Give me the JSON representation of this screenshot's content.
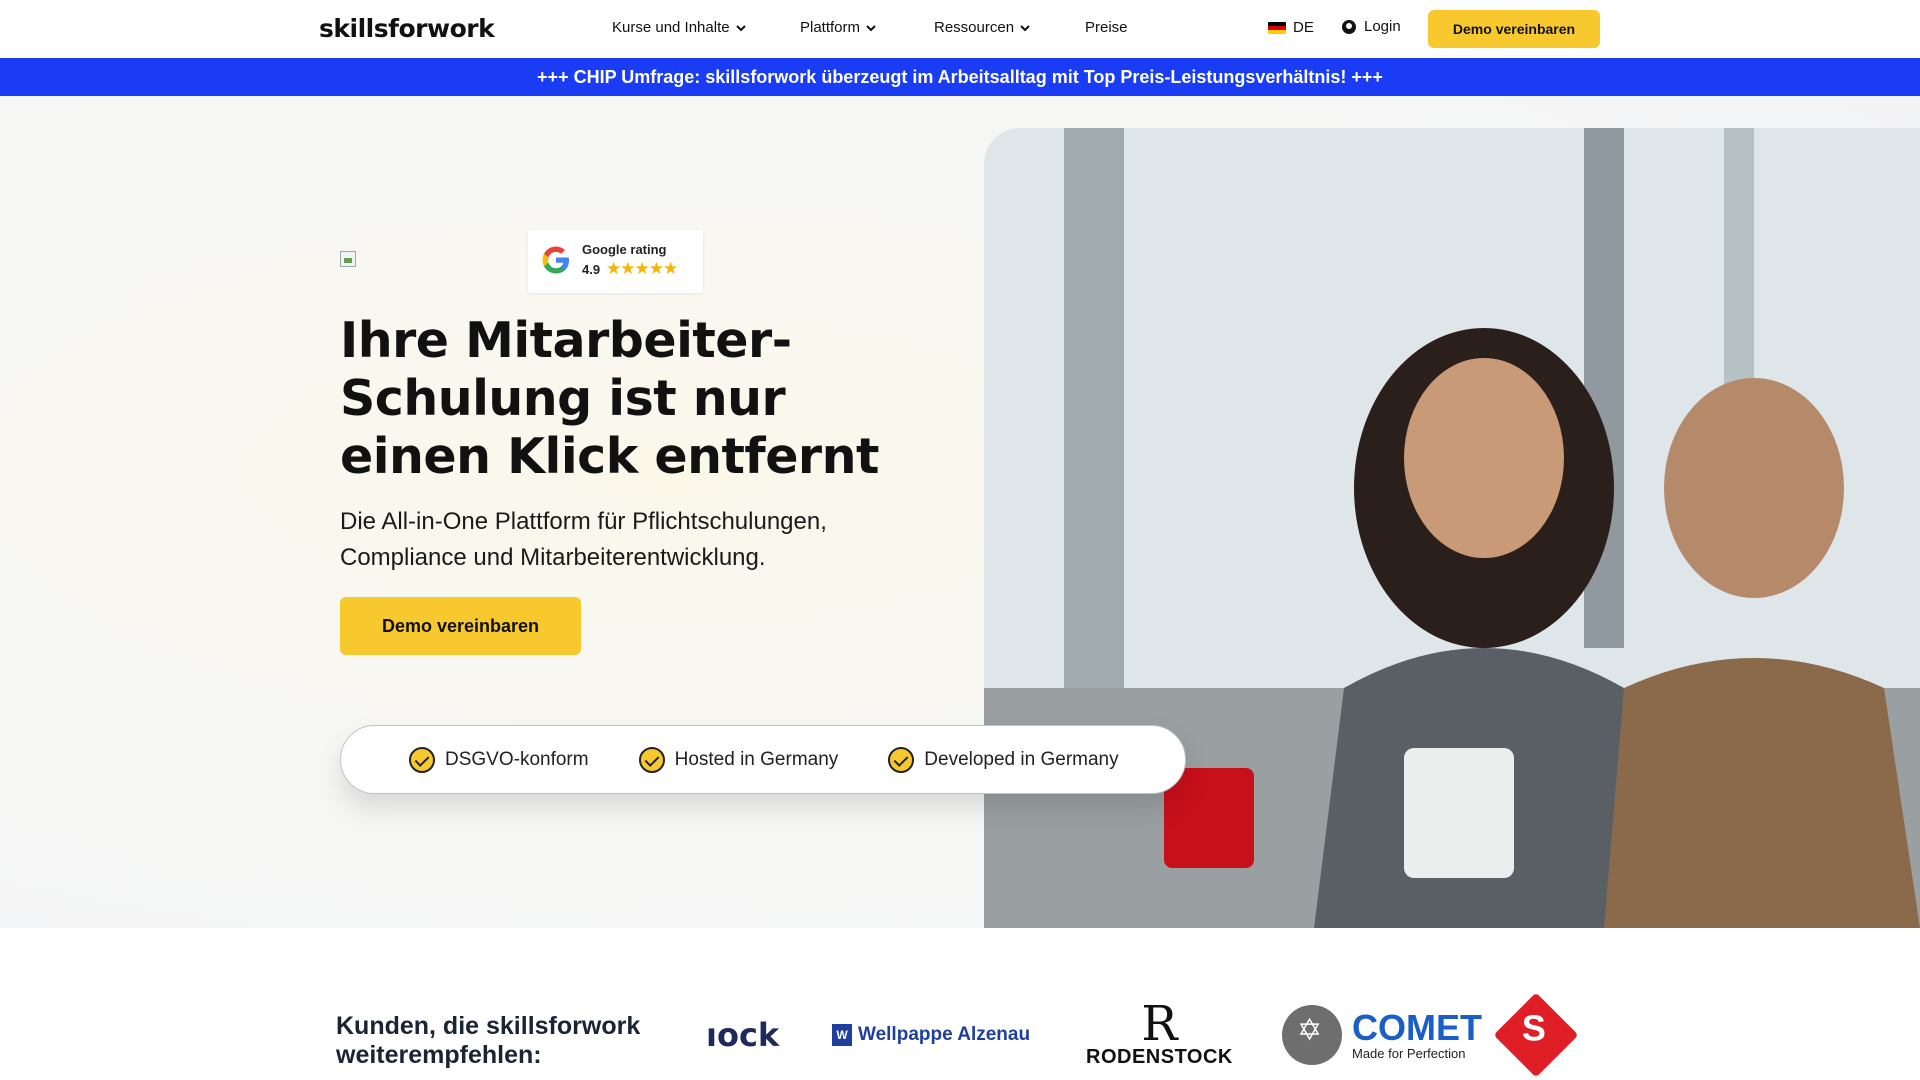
{
  "nav": {
    "brand": "skillsforwork",
    "items": [
      {
        "label": "Kurse und Inhalte",
        "dropdown": true
      },
      {
        "label": "Plattform",
        "dropdown": true
      },
      {
        "label": "Ressourcen",
        "dropdown": true
      },
      {
        "label": "Preise",
        "dropdown": false
      }
    ],
    "language": "DE",
    "login": "Login",
    "cta": "Demo vereinbaren"
  },
  "banner": {
    "text": "+++ CHIP Umfrage: skillsforwork überzeugt im Arbeitsalltag mit Top Preis-Leistungsverhältnis! +++",
    "color": "#1a3cf5"
  },
  "hero": {
    "rating": {
      "title": "Google rating",
      "value": "4.9",
      "stars": "★★★★★"
    },
    "headline": "Ihre Mitarbeiter-Schulung ist nur einen Klick entfernt",
    "subline": "Die All-in-One Plattform für Pflichtschulungen, Compliance und Mitarbeiterentwicklung.",
    "cta": "Demo vereinbaren",
    "trust": [
      "DSGVO-konform",
      "Hosted in Germany",
      "Developed in Germany"
    ]
  },
  "customers": {
    "title": "Kunden, die skillsforwork weiterempfehlen:",
    "logos": {
      "l1": "ıock",
      "l2": "Wellpappe Alzenau",
      "l2_mark": "W",
      "l3_mark": "R",
      "l3": "RODENSTOCK",
      "l4": "COMET",
      "l4_tag": "Made for Perfection",
      "l5_mark": "S"
    }
  },
  "colors": {
    "accent": "#f8c92e",
    "banner": "#1a3cf5",
    "text": "#111111"
  }
}
